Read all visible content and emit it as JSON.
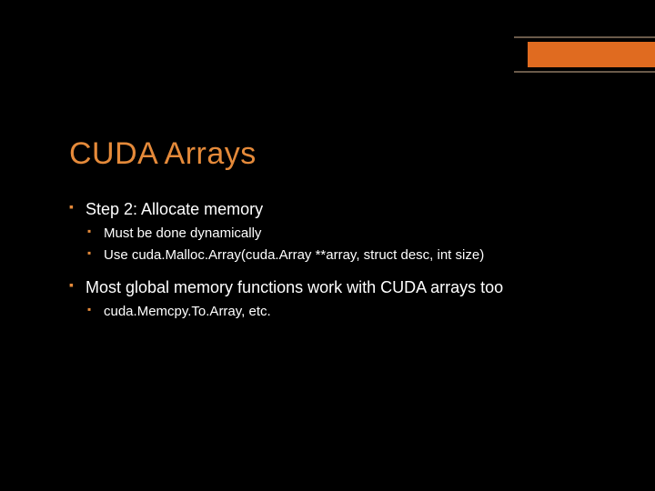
{
  "slide": {
    "title": "CUDA Arrays",
    "bullets": {
      "b1": "Step 2: Allocate memory",
      "b1a": "Must be done dynamically",
      "b1b": "Use cuda.Malloc.Array(cuda.Array **array, struct desc, int size)",
      "b2": "Most global memory functions work with CUDA arrays too",
      "b2a": "cuda.Memcpy.To.Array, etc."
    }
  }
}
